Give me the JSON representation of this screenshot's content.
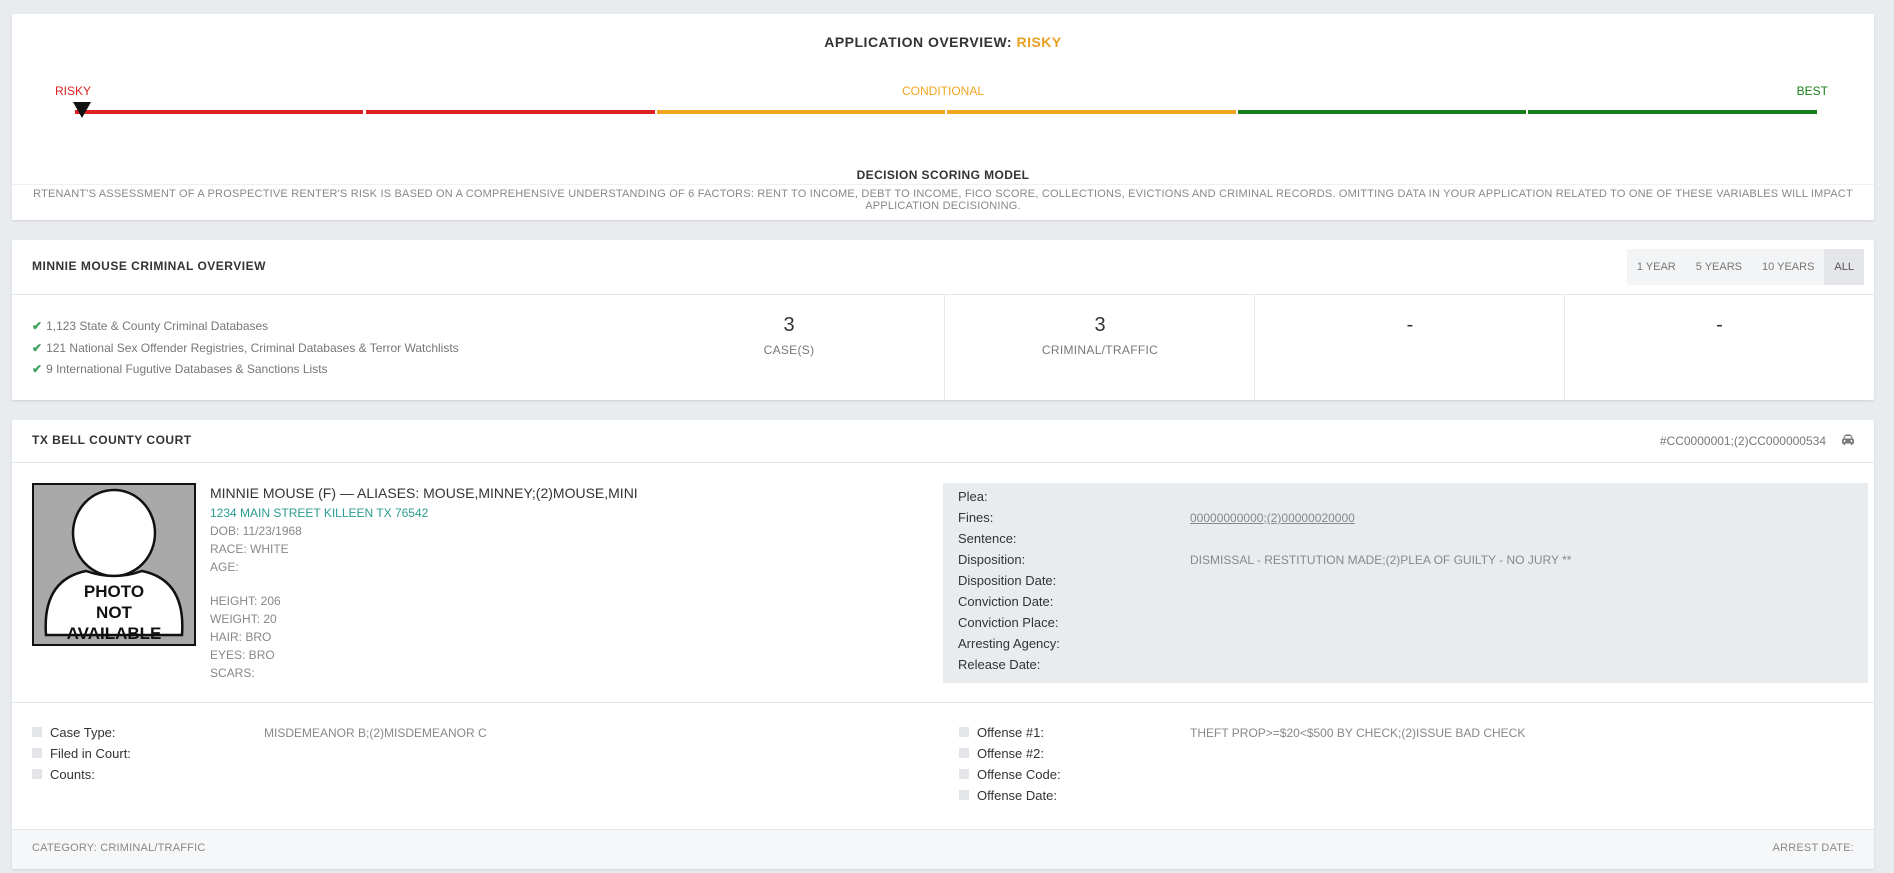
{
  "overview": {
    "title_prefix": "APPLICATION OVERVIEW: ",
    "title_value": "RISKY",
    "scale": {
      "left": "RISKY",
      "middle": "CONDITIONAL",
      "right": "BEST"
    },
    "colors": {
      "risky": "#e02020",
      "conditional": "#f0a520",
      "best": "#1a7f1a"
    },
    "decision_title": "DECISION SCORING MODEL",
    "decision_text": "RTENANT'S ASSESSMENT OF A PROSPECTIVE RENTER'S RISK IS BASED ON A COMPREHENSIVE UNDERSTANDING OF 6 FACTORS: RENT TO INCOME, DEBT TO INCOME, FICO SCORE, COLLECTIONS, EVICTIONS AND CRIMINAL RECORDS. OMITTING DATA IN YOUR APPLICATION RELATED TO ONE OF THESE VARIABLES WILL IMPACT APPLICATION DECISIONING."
  },
  "criminal": {
    "title": "MINNIE MOUSE CRIMINAL OVERVIEW",
    "ranges": [
      "1 YEAR",
      "5 YEARS",
      "10 YEARS",
      "ALL"
    ],
    "active_range": "ALL",
    "databases": [
      "1,123 State & County Criminal Databases",
      "121 National Sex Offender Registries, Criminal Databases & Terror Watchlists",
      "9 International Fugutive Databases & Sanctions Lists"
    ],
    "stats": [
      {
        "value": "3",
        "label": "CASE(S)"
      },
      {
        "value": "3",
        "label": "CRIMINAL/TRAFFIC"
      },
      {
        "value": "-",
        "label": ""
      },
      {
        "value": "-",
        "label": ""
      }
    ]
  },
  "court": {
    "title": "TX BELL COUNTY COURT",
    "case_number": "#CC0000001;(2)CC000000534",
    "icon": "car-icon",
    "photo_text": [
      "PHOTO",
      "NOT",
      "AVAILABLE"
    ],
    "person": {
      "name": "MINNIE MOUSE (F) — ALIASES: MOUSE,MINNEY;(2)MOUSE,MINI",
      "address": "1234 MAIN STREET KILLEEN TX 76542",
      "dob": "DOB: 11/23/1968",
      "race": "RACE: WHITE",
      "age": "AGE:",
      "height": "HEIGHT: 206",
      "weight": "WEIGHT: 20",
      "hair": "HAIR: BRO",
      "eyes": "EYES: BRO",
      "scars": "SCARS:"
    },
    "details": [
      {
        "label": "Plea:",
        "value": ""
      },
      {
        "label": "Fines:",
        "value": "00000000000;(2)00000020000"
      },
      {
        "label": "Sentence:",
        "value": ""
      },
      {
        "label": "Disposition:",
        "value": "DISMISSAL - RESTITUTION MADE;(2)PLEA OF GUILTY - NO JURY **"
      },
      {
        "label": "Disposition Date:",
        "value": ""
      },
      {
        "label": "Conviction Date:",
        "value": ""
      },
      {
        "label": "Conviction Place:",
        "value": ""
      },
      {
        "label": "Arresting Agency:",
        "value": ""
      },
      {
        "label": "Release Date:",
        "value": ""
      }
    ],
    "case_left": [
      {
        "label": "Case Type:",
        "value": "MISDEMEANOR B;(2)MISDEMEANOR C"
      },
      {
        "label": "Filed in Court:",
        "value": ""
      },
      {
        "label": "Counts:",
        "value": ""
      }
    ],
    "case_right": [
      {
        "label": "Offense #1:",
        "value": "THEFT PROP>=$20<$500 BY CHECK;(2)ISSUE BAD CHECK"
      },
      {
        "label": "Offense #2:",
        "value": ""
      },
      {
        "label": "Offense Code:",
        "value": ""
      },
      {
        "label": "Offense Date:",
        "value": ""
      }
    ],
    "footer_category": "CATEGORY: CRIMINAL/TRAFFIC",
    "footer_arrest": "ARREST DATE:"
  }
}
